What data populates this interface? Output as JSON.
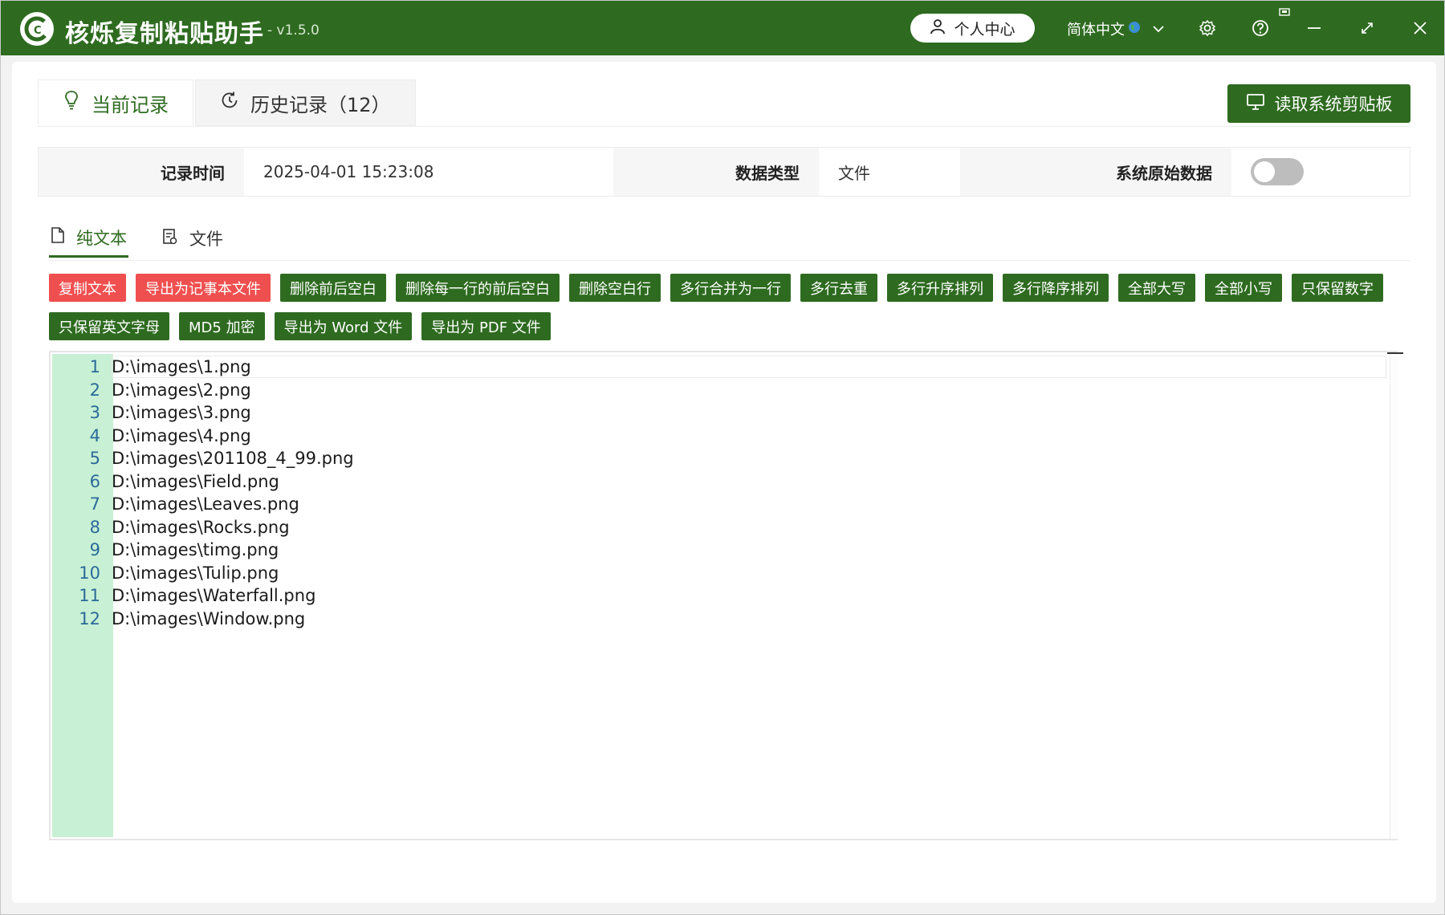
{
  "titlebar": {
    "app_name": "核烁复制粘贴助手",
    "version": "- v1.5.0",
    "user_center": "个人中心",
    "language": "简体中文",
    "icons": [
      "settings-icon",
      "help-icon",
      "minimize-icon",
      "maximize-icon",
      "close-icon"
    ]
  },
  "top_tabs": [
    {
      "label": "当前记录",
      "icon": "bulb-icon",
      "active": true
    },
    {
      "label": "历史记录（12）",
      "icon": "history-icon",
      "active": false
    }
  ],
  "read_clipboard_button": "读取系统剪贴板",
  "info": {
    "record_time_label": "记录时间",
    "record_time_value": "2025-04-01 15:23:08",
    "data_type_label": "数据类型",
    "data_type_value": "文件",
    "raw_data_label": "系统原始数据",
    "raw_data_enabled": false
  },
  "sub_tabs": [
    {
      "label": "纯文本",
      "icon": "document-icon",
      "active": true
    },
    {
      "label": "文件",
      "icon": "file-icon",
      "active": false
    }
  ],
  "toolbar": [
    {
      "label": "复制文本",
      "style": "red"
    },
    {
      "label": "导出为记事本文件",
      "style": "red"
    },
    {
      "label": "删除前后空白",
      "style": "green"
    },
    {
      "label": "删除每一行的前后空白",
      "style": "green"
    },
    {
      "label": "删除空白行",
      "style": "green"
    },
    {
      "label": "多行合并为一行",
      "style": "green"
    },
    {
      "label": "多行去重",
      "style": "green"
    },
    {
      "label": "多行升序排列",
      "style": "green"
    },
    {
      "label": "多行降序排列",
      "style": "green"
    },
    {
      "label": "全部大写",
      "style": "green"
    },
    {
      "label": "全部小写",
      "style": "green"
    },
    {
      "label": "只保留数字",
      "style": "green"
    },
    {
      "label": "只保留英文字母",
      "style": "green"
    },
    {
      "label": "MD5 加密",
      "style": "green"
    },
    {
      "label": "导出为 Word 文件",
      "style": "green"
    },
    {
      "label": "导出为 PDF 文件",
      "style": "green"
    }
  ],
  "editor": {
    "lines": [
      "D:\\images\\1.png",
      "D:\\images\\2.png",
      "D:\\images\\3.png",
      "D:\\images\\4.png",
      "D:\\images\\201108_4_99.png",
      "D:\\images\\Field.png",
      "D:\\images\\Leaves.png",
      "D:\\images\\Rocks.png",
      "D:\\images\\timg.png",
      "D:\\images\\Tulip.png",
      "D:\\images\\Waterfall.png",
      "D:\\images\\Window.png"
    ]
  },
  "colors": {
    "primary_green": "#2e6b20",
    "accent_red": "#ef4f4f",
    "gutter_green": "#c8f0d4",
    "line_number_blue": "#2b6b99"
  }
}
